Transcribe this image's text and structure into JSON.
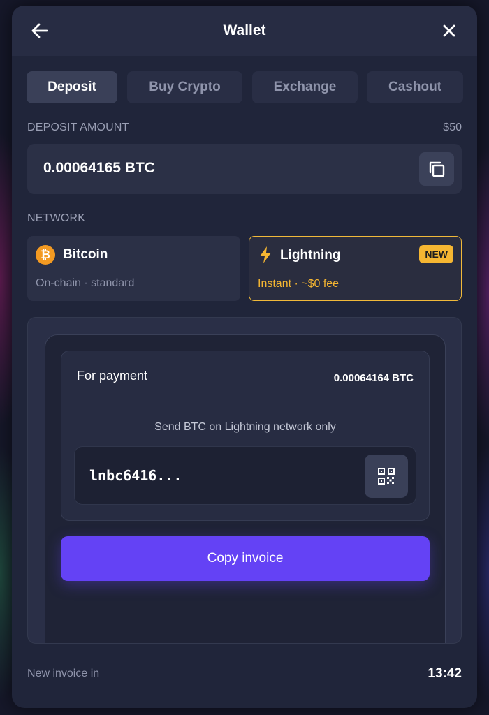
{
  "header": {
    "title": "Wallet",
    "back_icon": "arrow-left-icon",
    "close_icon": "close-icon"
  },
  "tabs": [
    {
      "label": "Deposit",
      "active": true
    },
    {
      "label": "Buy Crypto",
      "active": false
    },
    {
      "label": "Exchange",
      "active": false
    },
    {
      "label": "Cashout",
      "active": false
    }
  ],
  "deposit": {
    "label": "DEPOSIT AMOUNT",
    "usd_value": "$50",
    "amount": "0.00064165 BTC",
    "copy_icon": "copy-icon"
  },
  "network": {
    "label": "NETWORK",
    "options": [
      {
        "name": "Bitcoin",
        "subtitle": "On-chain · standard",
        "icon": "bitcoin-icon",
        "selected": false
      },
      {
        "name": "Lightning",
        "subtitle": "Instant · ~$0 fee",
        "icon": "lightning-bolt-icon",
        "badge": "NEW",
        "selected": true
      }
    ]
  },
  "payment": {
    "label": "For payment",
    "amount": "0.00064164 BTC",
    "network_note": "Send BTC on Lightning network only",
    "invoice": "lnbc6416...",
    "qr_icon": "qr-code-icon",
    "copy_button": "Copy invoice"
  },
  "footer": {
    "label": "New invoice in",
    "timer": "13:42"
  },
  "colors": {
    "accent": "#6442f5",
    "highlight": "#f0b93a",
    "bitcoin": "#f39a22"
  }
}
